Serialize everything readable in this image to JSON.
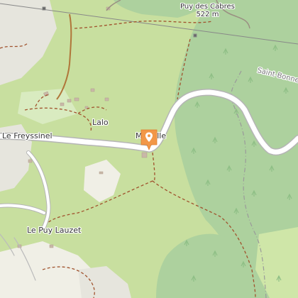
{
  "map": {
    "labels": {
      "peak_name": "Puy des Cabres",
      "peak_elevation": "522 m",
      "hamlet_1": "Lalo",
      "hamlet_2": "Le Freyssinel",
      "hamlet_3": "Le Puy Lauzet",
      "place_partial": "M... alle",
      "road_name": "Saint-Bonnet"
    },
    "marker_icon": "map-pin-icon",
    "colors": {
      "meadow": "#c8df9f",
      "forest": "#add19e",
      "built": "#f0efe6",
      "road": "#ffffff",
      "road_casing": "#b5b5b5",
      "path": "#a0522d",
      "marker": "#f29747"
    }
  }
}
